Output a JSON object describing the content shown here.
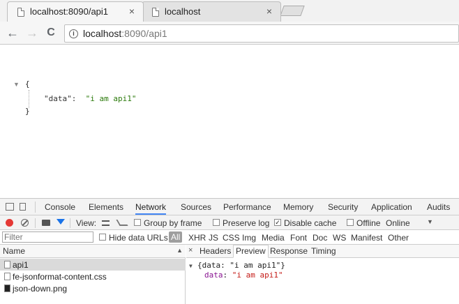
{
  "browser": {
    "tabs": [
      {
        "title": "localhost:8090/api1",
        "active": true
      },
      {
        "title": "localhost",
        "active": false
      }
    ],
    "close_glyph": "×",
    "address": {
      "host": "localhost",
      "rest": ":8090/api1"
    },
    "nav": {
      "back": "←",
      "forward": "→",
      "reload": "C"
    }
  },
  "page": {
    "toggle": "▼",
    "open_brace": "{",
    "close_brace": "}",
    "key": "\"data\"",
    "separator": ":",
    "value": "\"i am api1\""
  },
  "devtools": {
    "tabs": [
      "Console",
      "Elements",
      "Network",
      "Sources",
      "Performance",
      "Memory",
      "Security",
      "Application",
      "Audits"
    ],
    "active_tab": "Network",
    "toolbar": {
      "view_label": "View:",
      "group_by_frame": "Group by frame",
      "preserve_log": "Preserve log",
      "disable_cache": "Disable cache",
      "offline": "Offline",
      "online": "Online",
      "check_mark": "✓"
    },
    "filter": {
      "placeholder": "Filter",
      "hide_data_urls": "Hide data URLs",
      "types": [
        "All",
        "XHR",
        "JS",
        "CSS",
        "Img",
        "Media",
        "Font",
        "Doc",
        "WS",
        "Manifest",
        "Other"
      ],
      "active_type": "All"
    },
    "request_list": {
      "header": "Name",
      "sort_glyph": "▲",
      "rows": [
        {
          "name": "api1",
          "selected": true
        },
        {
          "name": "fe-jsonformat-content.css",
          "selected": false
        },
        {
          "name": "json-down.png",
          "selected": false
        }
      ]
    },
    "details": {
      "close_glyph": "×",
      "tabs": [
        "Headers",
        "Preview",
        "Response",
        "Timing"
      ],
      "active_tab": "Preview",
      "tree_toggle": "▼",
      "summary": "{data: \"i am api1\"}",
      "key": "data",
      "colon": ":",
      "value": "\"i am api1\""
    }
  }
}
